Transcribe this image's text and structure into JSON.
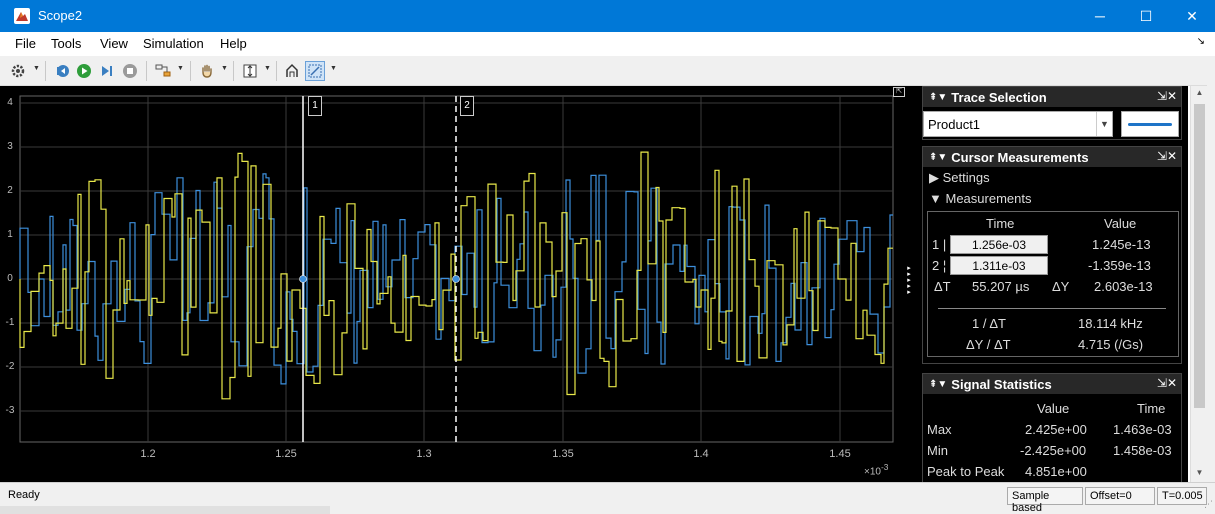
{
  "window": {
    "title": "Scope2",
    "icon": "matlab-scope-icon",
    "controls": {
      "minimize": "─",
      "maximize": "☐",
      "close": "✕"
    }
  },
  "menu": {
    "items": [
      "File",
      "Tools",
      "View",
      "Simulation",
      "Help"
    ],
    "dock_arrow": "↘"
  },
  "toolbar": {
    "icons": [
      "settings-gear-icon",
      "step-back-icon",
      "run-icon",
      "step-forward-icon",
      "stop-icon",
      "highlight-simulink-block-icon",
      "pan-hand-icon",
      "scale-axes-icon",
      "cursor-measurements-icon",
      "zoom-icon"
    ]
  },
  "plot": {
    "y_ticks": [
      "4",
      "3",
      "2",
      "1",
      "0",
      "-1",
      "-2",
      "-3"
    ],
    "x_ticks": [
      "1.2",
      "1.25",
      "1.3",
      "1.35",
      "1.4",
      "1.45"
    ],
    "x_exponent": "×10",
    "x_exponent_power": "-3",
    "cursor1_label": "1",
    "cursor2_label": "2",
    "colors": {
      "background": "#000000",
      "grid": "#3a3a3a",
      "trace_blue": "#3d8fdc",
      "trace_yellow": "#e8e84a",
      "cursor": "#ffffff"
    }
  },
  "trace_selection": {
    "title": "Trace Selection",
    "selected": "Product1",
    "swatch_color": "#1e74c8"
  },
  "cursor_measurements": {
    "title": "Cursor Measurements",
    "settings_label": "Settings",
    "measurements_label": "Measurements",
    "col_time": "Time",
    "col_value": "Value",
    "c1_label": "1 |",
    "c1_time": "1.256e-03",
    "c1_value": "1.245e-13",
    "c2_label": "2 ¦",
    "c2_time": "1.311e-03",
    "c2_value": "-1.359e-13",
    "dt_label": "ΔT",
    "dt_value": "55.207 µs",
    "dy_label": "ΔY",
    "dy_value": "2.603e-13",
    "inv_dt_label": "1 / ΔT",
    "inv_dt_value": "18.114 kHz",
    "dydt_label": "ΔY / ΔT",
    "dydt_value": "4.715 (/Gs)"
  },
  "signal_statistics": {
    "title": "Signal Statistics",
    "col_value": "Value",
    "col_time": "Time",
    "rows": [
      {
        "label": "Max",
        "value": "2.425e+00",
        "time": "1.463e-03"
      },
      {
        "label": "Min",
        "value": "-2.425e+00",
        "time": "1.458e-03"
      },
      {
        "label": "Peak to Peak",
        "value": "4.851e+00",
        "time": ""
      }
    ]
  },
  "status": {
    "text": "Ready",
    "mode": "Sample based",
    "offset": "Offset=0",
    "time": "T=0.005"
  }
}
